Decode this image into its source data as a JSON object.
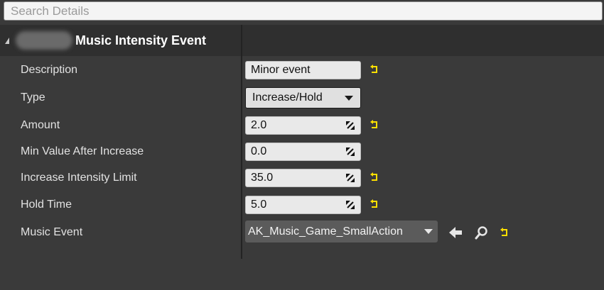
{
  "search": {
    "placeholder": "Search Details",
    "value": ""
  },
  "category": {
    "title": "Music Intensity Event"
  },
  "properties": {
    "description": {
      "label": "Description",
      "value": "Minor event"
    },
    "type": {
      "label": "Type",
      "value": "Increase/Hold"
    },
    "amount": {
      "label": "Amount",
      "value": "2.0"
    },
    "min_value": {
      "label": "Min Value After Increase",
      "value": "0.0"
    },
    "intensity_limit": {
      "label": "Increase Intensity Limit",
      "value": "35.0"
    },
    "hold_time": {
      "label": "Hold Time",
      "value": "5.0"
    },
    "music_event": {
      "label": "Music Event",
      "value": "AK_Music_Game_SmallAction"
    }
  },
  "colors": {
    "panel_bg": "#3a3a3a",
    "header_bg": "#2f2f2f",
    "reset_arrow": "#ffe000"
  },
  "icons": {
    "expander": "triangle-expanded-icon",
    "reset": "reset-to-default-icon",
    "spin": "drag-spin-arrows-icon",
    "use_selected": "use-selected-arrow-icon",
    "browse": "browse-magnifier-icon",
    "dropdown": "chevron-down-icon"
  }
}
